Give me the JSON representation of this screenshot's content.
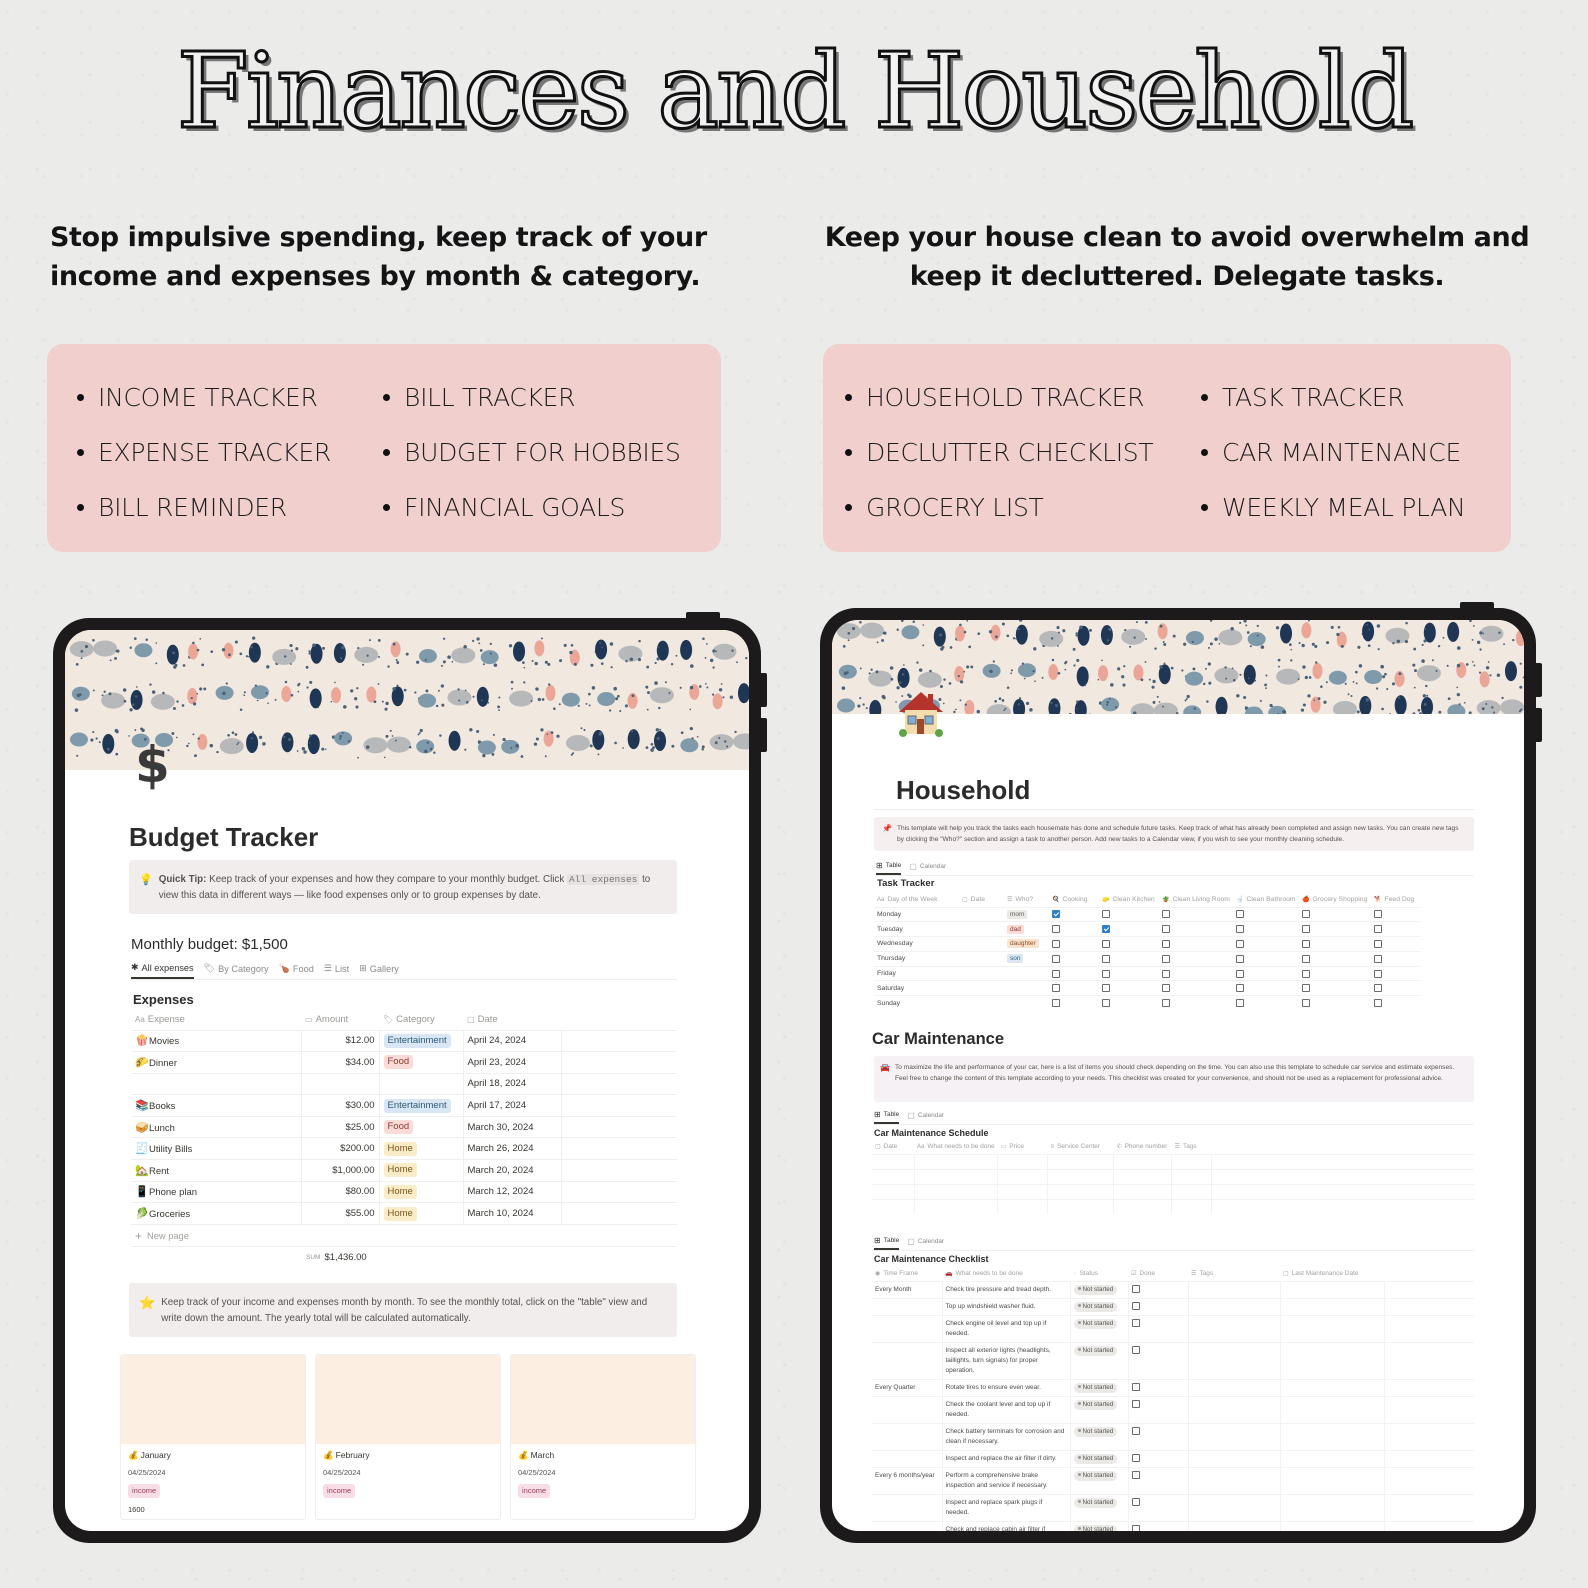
{
  "headline": "Finances and Household",
  "taglines": {
    "finance": "Stop impulsive spending, keep track of your income and expenses by month & category.",
    "household": "Keep your house clean to avoid overwhelm and keep it decluttered. Delegate tasks."
  },
  "features": {
    "finance": [
      "INCOME TRACKER",
      "EXPENSE TRACKER",
      "BILL REMINDER",
      "BILL TRACKER",
      "BUDGET FOR HOBBIES",
      "FINANCIAL GOALS"
    ],
    "household": [
      "HOUSEHOLD TRACKER",
      "DECLUTTER CHECKLIST",
      "GROCERY LIST",
      "TASK TRACKER",
      "CAR MAINTENANCE",
      "WEEKLY MEAL PLAN"
    ]
  },
  "colors": {
    "feature_box": "#f0cfcd",
    "tablet_frame": "#1c1a1a",
    "checkbox_checked": "#2f80c9"
  },
  "budget": {
    "icon": "$",
    "title": "Budget Tracker",
    "tip_label": "Quick Tip:",
    "tip_text_1": " Keep track of your expenses and how they compare to your monthly budget. Click ",
    "tip_code": "All expenses",
    "tip_text_2": " to view this data in different ways — like food expenses only or to group expenses by date.",
    "monthly_budget": "Monthly budget: $1,500",
    "tabs": [
      {
        "icon": "✱",
        "label": "All expenses"
      },
      {
        "icon": "🏷",
        "label": "By Category"
      },
      {
        "icon": "🍗",
        "label": "Food"
      },
      {
        "icon": "☰",
        "label": "List"
      },
      {
        "icon": "⊞",
        "label": "Gallery"
      }
    ],
    "table_title": "Expenses",
    "columns": [
      {
        "icon": "Aa",
        "label": "Expense"
      },
      {
        "icon": "▭",
        "label": "Amount"
      },
      {
        "icon": "🏷",
        "label": "Category"
      },
      {
        "icon": "▢",
        "label": "Date"
      }
    ],
    "rows": [
      {
        "emoji": "🍿",
        "name": "Movies",
        "amount": "$12.00",
        "category": "Entertainment",
        "cat_class": "tag-ent",
        "date": "April 24, 2024"
      },
      {
        "emoji": "🌮",
        "name": "Dinner",
        "amount": "$34.00",
        "category": "Food",
        "cat_class": "tag-food",
        "date": "April 23, 2024"
      },
      {
        "emoji": "",
        "name": "",
        "amount": "",
        "category": "",
        "cat_class": "",
        "date": "April 18, 2024"
      },
      {
        "emoji": "📚",
        "name": "Books",
        "amount": "$30.00",
        "category": "Entertainment",
        "cat_class": "tag-ent",
        "date": "April 17, 2024"
      },
      {
        "emoji": "🥪",
        "name": "Lunch",
        "amount": "$25.00",
        "category": "Food",
        "cat_class": "tag-food",
        "date": "March 30, 2024"
      },
      {
        "emoji": "🧾",
        "name": "Utility Bills",
        "amount": "$200.00",
        "category": "Home",
        "cat_class": "tag-home",
        "date": "March 26, 2024"
      },
      {
        "emoji": "🏡",
        "name": "Rent",
        "amount": "$1,000.00",
        "category": "Home",
        "cat_class": "tag-home",
        "date": "March 20, 2024"
      },
      {
        "emoji": "📱",
        "name": "Phone plan",
        "amount": "$80.00",
        "category": "Home",
        "cat_class": "tag-home",
        "date": "March 12, 2024"
      },
      {
        "emoji": "🥬",
        "name": "Groceries",
        "amount": "$55.00",
        "category": "Home",
        "cat_class": "tag-home",
        "date": "March 10, 2024"
      }
    ],
    "new_page": "New page",
    "sum_label": "SUM",
    "sum_value": "$1,436.00",
    "callout2_icon": "⭐",
    "callout2": "Keep track of your income and expenses month by month. To see the monthly total, click on the \"table\" view and write down the amount. The yearly total will be calculated automatically.",
    "gallery": [
      {
        "icon": "💰",
        "month": "January",
        "date": "04/25/2024",
        "tag": "income",
        "amount": "1600"
      },
      {
        "icon": "💰",
        "month": "February",
        "date": "04/25/2024",
        "tag": "income",
        "amount": ""
      },
      {
        "icon": "💰",
        "month": "March",
        "date": "04/25/2024",
        "tag": "income",
        "amount": ""
      }
    ]
  },
  "household": {
    "title": "Household",
    "callout_icon": "📌",
    "callout": "This template will help you track the tasks each housemate has done and schedule future tasks. Keep track of what has already been completed and assign new tasks. You can create new tags by clicking the \"Who?\" section and assign a task to another person. Add new tasks to a Calendar view, if you wish to see your monthly cleaning schedule.",
    "view_tabs": [
      "Table",
      "Calendar"
    ],
    "task_tracker": {
      "title": "Task Tracker",
      "columns": [
        "Day of the Week",
        "Date",
        "Who?",
        "Cooking",
        "Clean Kitchen",
        "Clean Living Room",
        "Clean Bathroom",
        "Grocery Shopping",
        "Feed Dog"
      ],
      "rows": [
        {
          "day": "Monday",
          "who": "mom",
          "who_class": "who-mom",
          "checks": [
            true,
            false,
            false,
            false,
            false,
            false
          ]
        },
        {
          "day": "Tuesday",
          "who": "dad",
          "who_class": "who-dad",
          "checks": [
            false,
            true,
            false,
            false,
            false,
            false
          ]
        },
        {
          "day": "Wednesday",
          "who": "daughter",
          "who_class": "who-daughter",
          "checks": [
            false,
            false,
            false,
            false,
            false,
            false
          ]
        },
        {
          "day": "Thursday",
          "who": "son",
          "who_class": "who-son",
          "checks": [
            false,
            false,
            false,
            false,
            false,
            false
          ]
        },
        {
          "day": "Friday",
          "who": "",
          "who_class": "",
          "checks": [
            false,
            false,
            false,
            false,
            false,
            false
          ]
        },
        {
          "day": "Saturday",
          "who": "",
          "who_class": "",
          "checks": [
            false,
            false,
            false,
            false,
            false,
            false
          ]
        },
        {
          "day": "Sunday",
          "who": "",
          "who_class": "",
          "checks": [
            false,
            false,
            false,
            false,
            false,
            false
          ]
        }
      ]
    },
    "car": {
      "title": "Car Maintenance",
      "callout_icon": "🚘",
      "callout": "To maximize the life and performance of your car, here is a list of items you should check depending on the time. You can also use this template to schedule car service and estimate expenses. Feel free to change the content of this template according to your needs. This checklist was created for your convenience, and should not be used as a replacement for professional advice.",
      "schedule_title": "Car Maintenance Schedule",
      "schedule_columns": [
        "Date",
        "What needs to be done",
        "Price",
        "Service Center",
        "Phone number",
        "Tags"
      ],
      "checklist_title": "Car Maintenance Checklist",
      "checklist_columns": [
        "Time Frame",
        "What needs to be done",
        "Status",
        "Done",
        "Tags",
        "Last Maintenance Date"
      ],
      "checklist_rows": [
        {
          "frame": "Every Month",
          "task": "Check tire pressure and tread depth.",
          "status": "Not started"
        },
        {
          "frame": "",
          "task": "Top up windshield washer fluid.",
          "status": "Not started"
        },
        {
          "frame": "",
          "task": "Check engine oil level and top up if needed.",
          "status": "Not started"
        },
        {
          "frame": "",
          "task": "Inspect all exterior lights (headlights, taillights, turn signals) for proper operation.",
          "status": "Not started"
        },
        {
          "frame": "Every Quarter",
          "task": "Rotate tires to ensure even wear.",
          "status": "Not started"
        },
        {
          "frame": "",
          "task": "Check the coolant level and top up if needed.",
          "status": "Not started"
        },
        {
          "frame": "",
          "task": "Check battery terminals for corrosion and clean if necessary.",
          "status": "Not started"
        },
        {
          "frame": "",
          "task": "Inspect and replace the air filter if dirty.",
          "status": "Not started"
        },
        {
          "frame": "Every 6 months/year",
          "task": "Perform a comprehensive brake inspection and service if necessary.",
          "status": "Not started"
        },
        {
          "frame": "",
          "task": "Inspect and replace spark plugs if needed.",
          "status": "Not started"
        },
        {
          "frame": "",
          "task": "Check and replace cabin air filter if",
          "status": "Not started"
        }
      ]
    }
  }
}
